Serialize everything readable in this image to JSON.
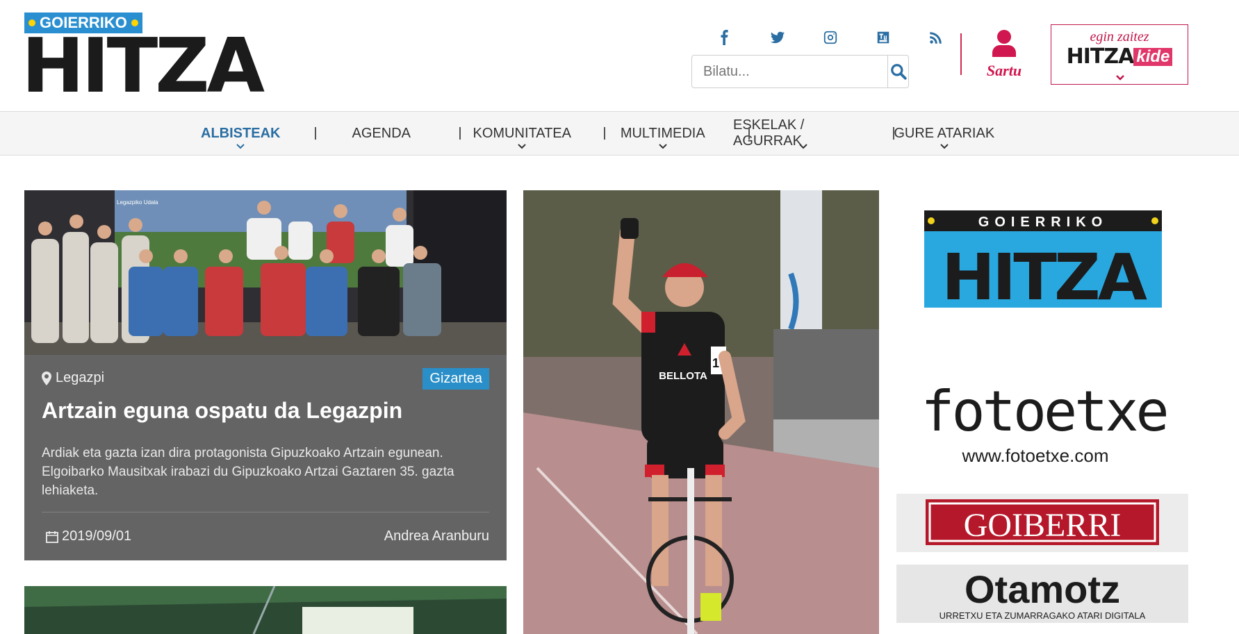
{
  "logo": {
    "tag": "GOIERRIKO",
    "word": "HITZA"
  },
  "social": [
    {
      "name": "facebook-icon",
      "glyph": "f"
    },
    {
      "name": "twitter-icon",
      "glyph": "t"
    },
    {
      "name": "instagram-icon",
      "glyph": "i"
    },
    {
      "name": "youtube-icon",
      "glyph": "y"
    },
    {
      "name": "rss-icon",
      "glyph": "r"
    }
  ],
  "search": {
    "placeholder": "Bilatu..."
  },
  "login": {
    "label": "Sartu"
  },
  "kide": {
    "line1": "egin zaitez",
    "brand": "HITZA",
    "suffix": "kide"
  },
  "nav": {
    "items": [
      {
        "label": "ALBISTEAK",
        "active": true
      },
      {
        "label": "AGENDA"
      },
      {
        "label": "KOMUNITATEA"
      },
      {
        "label": "MULTIMEDIA"
      },
      {
        "label": "ESKELAK / AGURRAK"
      },
      {
        "label": "GURE ATARIAK"
      }
    ]
  },
  "article1": {
    "location": "Legazpi",
    "category": "Gizartea",
    "title": "Artzain eguna ospatu da Legazpin",
    "lead": "Ardiak eta gazta izan dira protagonista Gipuzkoako Artzain egunean. Elgoibarko Mausitxak irabazi du Gipuzkoako Artzai Gaztaren 35. gazta lehiaketa.",
    "date": "2019/09/01",
    "author": "Andrea Aranburu",
    "photo_text": "Legazpiko Udala"
  },
  "bigphoto": {
    "jersey": "BELLOTA",
    "bib": "17"
  },
  "ads": {
    "goierriko": {
      "tag": "GOIERRIKO",
      "word": "HITZA"
    },
    "fotoetxe": {
      "name": "fotoetxe",
      "url": "www.fotoetxe.com"
    },
    "goiberri": {
      "name": "GOIBERRI"
    },
    "otamotz": {
      "name": "Otamotz",
      "sub": "URRETXU ETA ZUMARRAGAKO ATARI DIGITALA"
    }
  },
  "colors": {
    "brand_blue": "#2a8fd1",
    "accent_red": "#d0174f",
    "nav_active": "#2a6ea3",
    "category_bg": "#2a8fc8"
  }
}
